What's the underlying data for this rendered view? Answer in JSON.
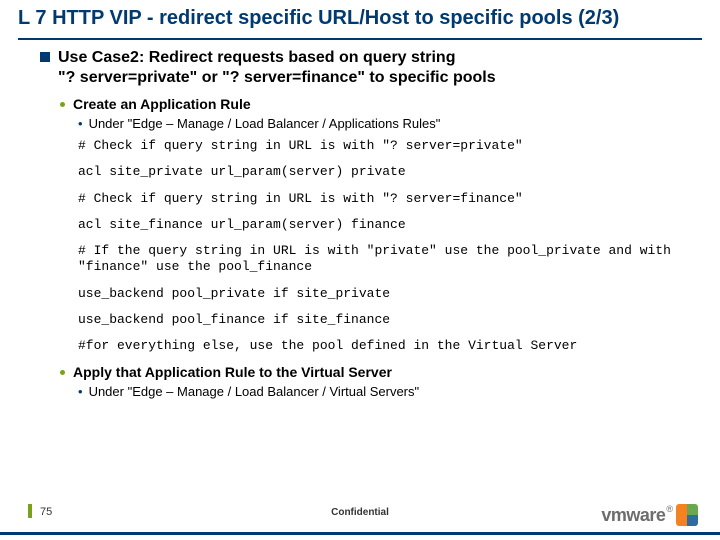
{
  "title": "L 7 HTTP VIP - redirect specific URL/Host to specific pools (2/3)",
  "usecase_lead": "Use Case2: Redirect requests based on query string",
  "usecase_sub": "\"? server=private\"  or \"? server=finance\" to specific pools",
  "create_rule": "Create an Application Rule",
  "create_rule_sub": "Under \"Edge – Manage /  Load Balancer / Applications Rules\"",
  "code": {
    "c1": "# Check if query string in URL is with \"? server=private\"",
    "c2": "acl site_private url_param(server) private",
    "c3": "# Check if query string in URL is with \"? server=finance\"",
    "c4": "acl site_finance url_param(server) finance",
    "c5": "# If the query string in URL is with \"private\" use the pool_private and with \"finance\" use the pool_finance",
    "c6": "use_backend pool_private if site_private",
    "c7": "use_backend pool_finance if site_finance",
    "c8": "#for everything else, use the pool defined in the Virtual Server"
  },
  "apply_rule": "Apply that Application Rule to the Virtual Server",
  "apply_rule_sub": "Under \"Edge – Manage /  Load Balancer / Virtual Servers\"",
  "page_number": "75",
  "confidential": "Confidential",
  "brand": "vmware"
}
